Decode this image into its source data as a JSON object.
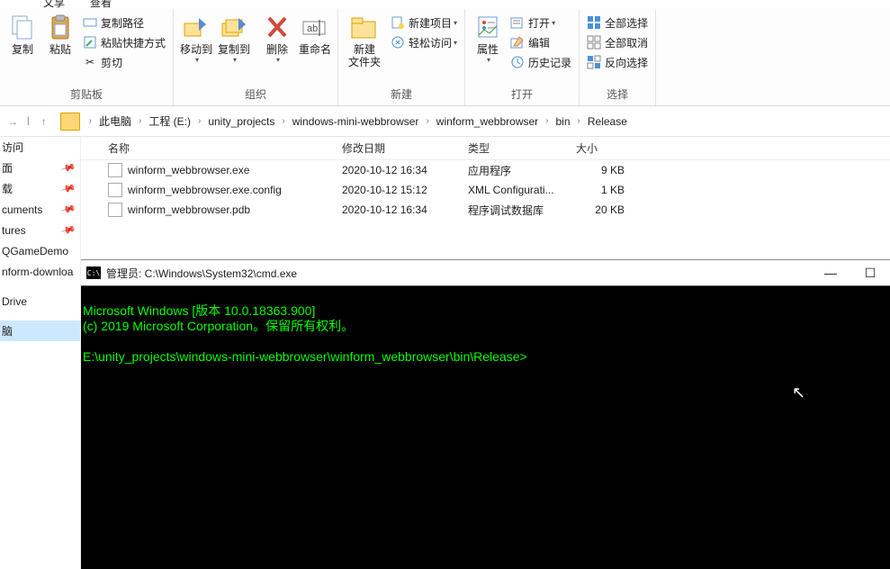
{
  "tabs": {
    "t1": "文享",
    "t2": "查看"
  },
  "ribbon": {
    "clipboard": {
      "copy": "复制",
      "paste": "粘贴",
      "copy_path": "复制路径",
      "paste_shortcut": "粘贴快捷方式",
      "cut": "剪切",
      "label": "剪贴板"
    },
    "organize": {
      "move_to": "移动到",
      "copy_to": "复制到",
      "delete": "删除",
      "rename": "重命名",
      "label": "组织"
    },
    "new_": {
      "new_folder": "新建\n文件夹",
      "new_item": "新建项目",
      "easy_access": "轻松访问",
      "label": "新建"
    },
    "open_": {
      "properties": "属性",
      "open": "打开",
      "edit": "编辑",
      "history": "历史记录",
      "label": "打开"
    },
    "select_": {
      "select_all": "全部选择",
      "select_none": "全部取消",
      "invert": "反向选择",
      "label": "选择"
    }
  },
  "breadcrumb": [
    "此电脑",
    "工程 (E:)",
    "unity_projects",
    "windows-mini-webbrowser",
    "winform_webbrowser",
    "bin",
    "Release"
  ],
  "sidebar_items": [
    "访问",
    "面",
    "载",
    "cuments",
    "tures",
    "QGameDemo",
    "nform-downloa",
    "Drive",
    "脑"
  ],
  "columns": {
    "name": "名称",
    "date": "修改日期",
    "type": "类型",
    "size": "大小"
  },
  "files": [
    {
      "name": "winform_webbrowser.exe",
      "date": "2020-10-12 16:34",
      "type": "应用程序",
      "size": "9 KB"
    },
    {
      "name": "winform_webbrowser.exe.config",
      "date": "2020-10-12 15:12",
      "type": "XML Configurati...",
      "size": "1 KB"
    },
    {
      "name": "winform_webbrowser.pdb",
      "date": "2020-10-12 16:34",
      "type": "程序调试数据库",
      "size": "20 KB"
    }
  ],
  "cmd": {
    "title": "管理员: C:\\Windows\\System32\\cmd.exe",
    "line1": "Microsoft Windows [版本 10.0.18363.900]",
    "line2": "(c) 2019 Microsoft Corporation。保留所有权利。",
    "prompt": "E:\\unity_projects\\windows-mini-webbrowser\\winform_webbrowser\\bin\\Release>"
  }
}
